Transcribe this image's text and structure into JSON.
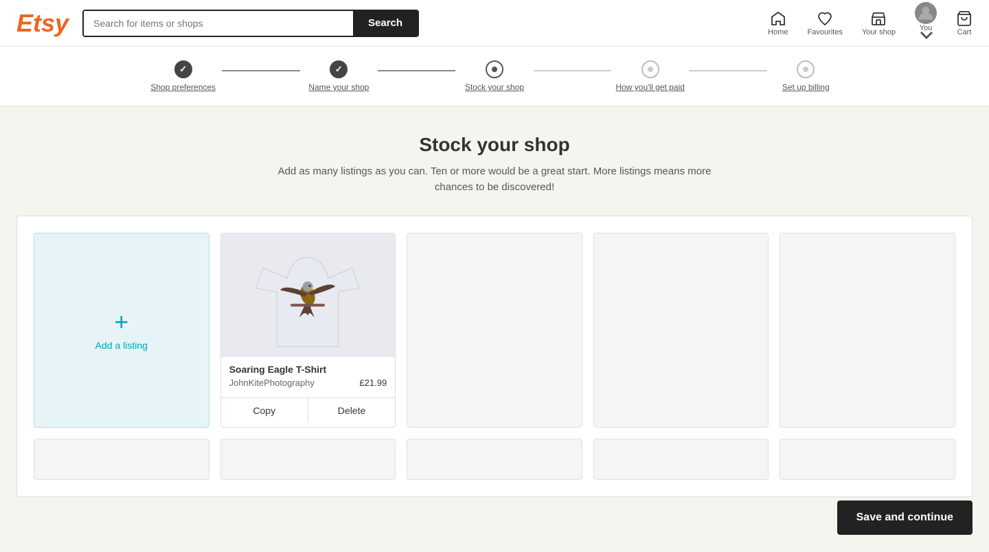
{
  "header": {
    "logo": "Etsy",
    "search_placeholder": "Search for items or shops",
    "search_label": "Search",
    "nav": [
      {
        "id": "home",
        "label": "Home",
        "icon": "home-icon"
      },
      {
        "id": "favourites",
        "label": "Favourites",
        "icon": "heart-icon"
      },
      {
        "id": "your-shop",
        "label": "Your shop",
        "icon": "shop-icon"
      },
      {
        "id": "you",
        "label": "You",
        "icon": "avatar-icon"
      },
      {
        "id": "cart",
        "label": "Cart",
        "icon": "cart-icon"
      }
    ]
  },
  "progress": {
    "steps": [
      {
        "id": "shop-preferences",
        "label": "Shop preferences",
        "state": "completed"
      },
      {
        "id": "name-your-shop",
        "label": "Name your shop",
        "state": "completed"
      },
      {
        "id": "stock-your-shop",
        "label": "Stock your shop",
        "state": "active"
      },
      {
        "id": "how-youll-get-paid",
        "label": "How you'll get paid",
        "state": "inactive"
      },
      {
        "id": "set-up-billing",
        "label": "Set up billing",
        "state": "inactive"
      }
    ]
  },
  "main": {
    "title": "Stock your shop",
    "subtitle": "Add as many listings as you can. Ten or more would be a great start. More listings means more chances to be discovered!",
    "add_listing_label": "Add a listing",
    "add_listing_icon": "+",
    "listings": [
      {
        "id": "soaring-eagle",
        "name": "Soaring Eagle T-Shirt",
        "shop": "JohnKitePhotography",
        "price": "£21.99",
        "has_image": true
      }
    ],
    "copy_label": "Copy",
    "delete_label": "Delete"
  },
  "footer": {
    "save_button": "Save and continue"
  }
}
